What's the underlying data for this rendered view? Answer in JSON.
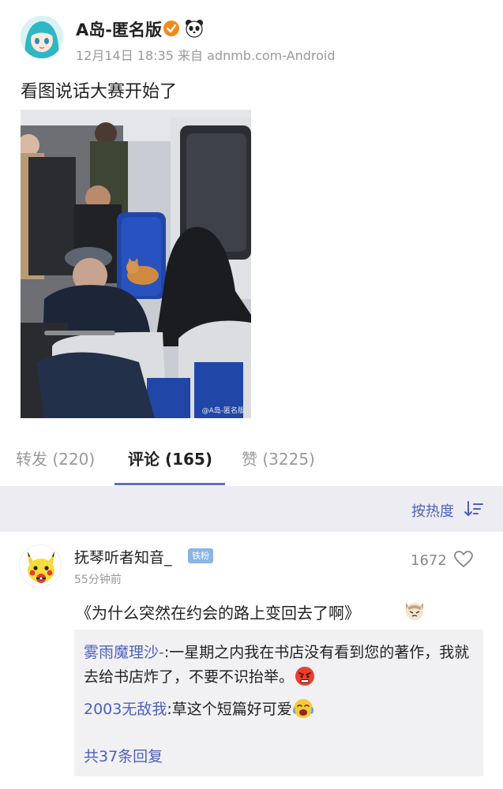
{
  "post": {
    "username": "A岛-匿名版",
    "timestamp": "12月14日 18:35",
    "source": "来自 adnmb.com-Android",
    "text": "看图说话大赛开始了",
    "image_watermark": "@A岛-匿名版"
  },
  "tabs": {
    "repost": "转发 (220)",
    "comments": "评论 (165)",
    "likes": "赞 (3225)"
  },
  "sort": {
    "label": "按热度"
  },
  "comment": {
    "author": "抚琴听者知音_",
    "badge": "铁粉",
    "time": "55分钟前",
    "likes": "1672",
    "text": "《为什么突然在约会的路上变回去了啊》",
    "replies": [
      {
        "author": "雾雨魔理沙-",
        "text": ":一星期之内我在书店没有看到您的著作，我就去给书店炸了，不要不识抬举。"
      },
      {
        "author": "2003无敌我",
        "text": ":草这个短篇好可爱"
      }
    ],
    "more_replies": "共37条回复"
  }
}
